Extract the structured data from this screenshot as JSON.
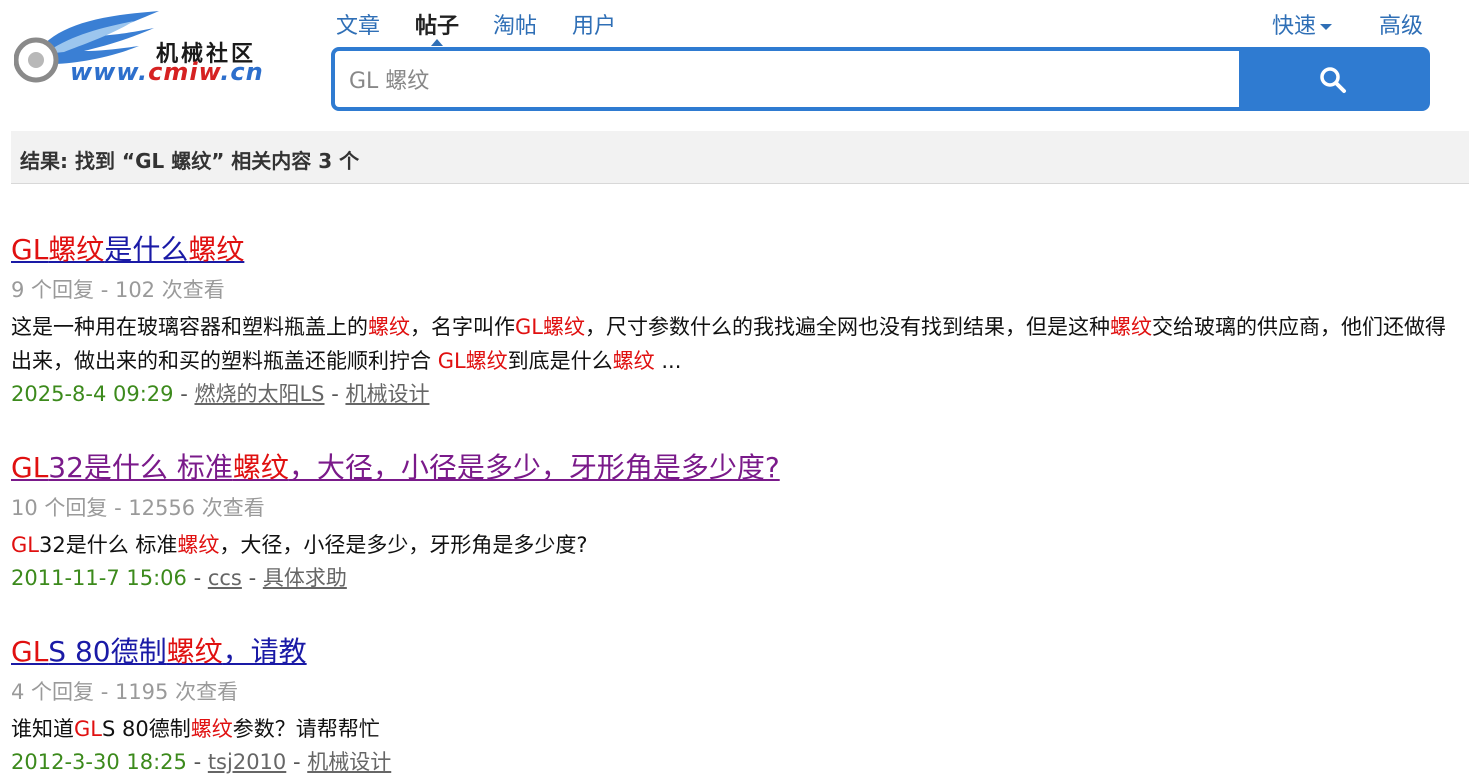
{
  "logo": {
    "text": "机械社区",
    "url_prefix": "www.",
    "url_mid": "cmiw",
    "url_suffix": ".cn"
  },
  "nav": {
    "tabs": [
      {
        "label": "文章",
        "active": false
      },
      {
        "label": "帖子",
        "active": true
      },
      {
        "label": "淘帖",
        "active": false
      },
      {
        "label": "用户",
        "active": false
      }
    ]
  },
  "right_links": {
    "quick": "快速",
    "advanced": "高级"
  },
  "search": {
    "value": "GL 螺纹",
    "icon": "search-icon"
  },
  "result_summary": "结果: 找到 “GL 螺纹” 相关内容 3 个",
  "results": [
    {
      "title_parts": [
        {
          "text": "GL",
          "hl": true
        },
        {
          "text": "螺纹",
          "hl": true
        },
        {
          "text": "是什么",
          "hl": false
        },
        {
          "text": "螺纹",
          "hl": true
        }
      ],
      "stats": "9 个回复 - 102 次查看",
      "snippet_parts": [
        {
          "text": "这是一种用在玻璃容器和塑料瓶盖上的",
          "hl": false
        },
        {
          "text": "螺纹",
          "hl": true
        },
        {
          "text": "，名字叫作",
          "hl": false
        },
        {
          "text": "GL",
          "hl": true
        },
        {
          "text": "螺纹",
          "hl": true
        },
        {
          "text": "，尺寸参数什么的我找遍全网也没有找到结果，但是这种",
          "hl": false
        },
        {
          "text": "螺纹",
          "hl": true
        },
        {
          "text": "交给玻璃的供应商，他们还做得出来，做出来的和买的塑料瓶盖还能顺利拧合 ",
          "hl": false
        },
        {
          "text": "GL",
          "hl": true
        },
        {
          "text": "螺纹",
          "hl": true
        },
        {
          "text": "到底是什么",
          "hl": false
        },
        {
          "text": "螺纹",
          "hl": true
        },
        {
          "text": " ...",
          "hl": false
        }
      ],
      "date": "2025-8-4 09:29",
      "author": "燃烧的太阳LS",
      "forum": "机械设计",
      "visited": false
    },
    {
      "title_parts": [
        {
          "text": "GL",
          "hl": true
        },
        {
          "text": "32是什么 标准",
          "hl": false
        },
        {
          "text": "螺纹",
          "hl": true
        },
        {
          "text": "，大径，小径是多少，牙形角是多少度? ",
          "hl": false
        }
      ],
      "stats": "10 个回复 - 12556 次查看",
      "snippet_parts": [
        {
          "text": "GL",
          "hl": true
        },
        {
          "text": "32是什么 标准",
          "hl": false
        },
        {
          "text": "螺纹",
          "hl": true
        },
        {
          "text": "，大径，小径是多少，牙形角是多少度?",
          "hl": false
        }
      ],
      "date": "2011-11-7 15:06",
      "author": "ccs",
      "forum": "具体求助",
      "visited": true
    },
    {
      "title_parts": [
        {
          "text": "GL",
          "hl": true
        },
        {
          "text": "S 80德制",
          "hl": false
        },
        {
          "text": "螺纹",
          "hl": true
        },
        {
          "text": "，请教",
          "hl": false
        }
      ],
      "stats": "4 个回复 - 1195 次查看",
      "snippet_parts": [
        {
          "text": "谁知道",
          "hl": false
        },
        {
          "text": "GL",
          "hl": true
        },
        {
          "text": "S 80德制",
          "hl": false
        },
        {
          "text": "螺纹",
          "hl": true
        },
        {
          "text": "参数？请帮帮忙",
          "hl": false
        }
      ],
      "date": "2012-3-30 18:25",
      "author": "tsj2010",
      "forum": "机械设计",
      "visited": false
    }
  ]
}
